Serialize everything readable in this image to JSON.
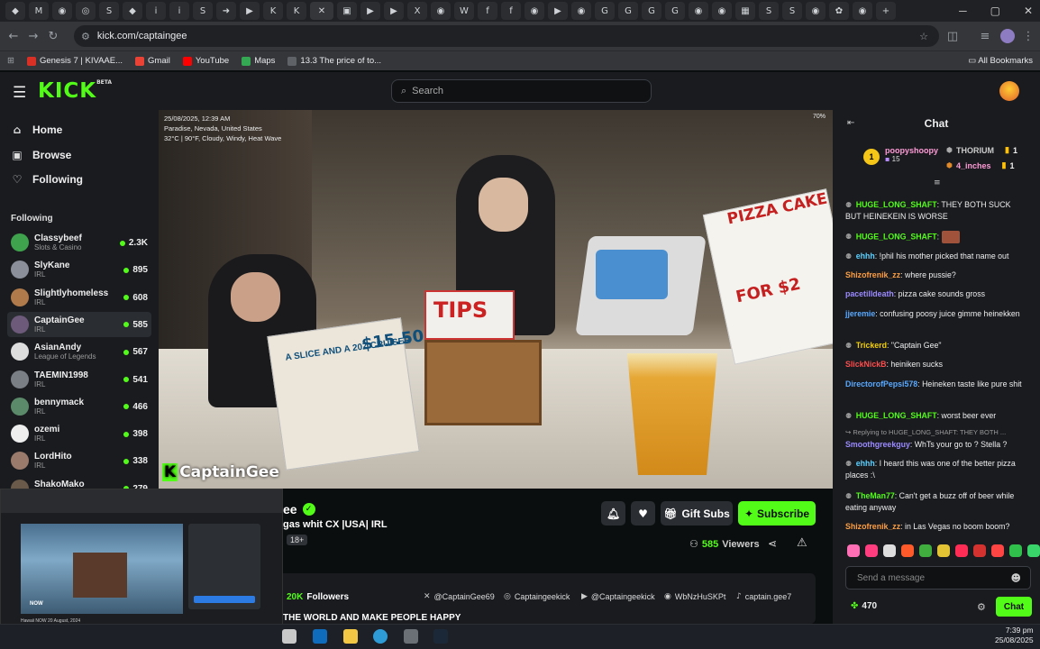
{
  "browser": {
    "tab_glyphs": [
      "◆",
      "M",
      "◉",
      "◎",
      "S",
      "◆",
      "i",
      "i",
      "S",
      "➜",
      "▶",
      "K",
      "K",
      "✕",
      "▣",
      "▶",
      "▶",
      "X",
      "◉",
      "W",
      "f",
      "f",
      "◉",
      "▶",
      "◉",
      "G",
      "G",
      "G",
      "G",
      "◉",
      "◉",
      "▦",
      "S",
      "S",
      "◉",
      "✿",
      "◉"
    ],
    "url": "kick.com/captaingee",
    "bookmarks": [
      {
        "label": "Genesis 7 | KIVAAE...",
        "color": "#d93025"
      },
      {
        "label": "Gmail",
        "color": "#ea4335"
      },
      {
        "label": "YouTube",
        "color": "#ff0000"
      },
      {
        "label": "Maps",
        "color": "#34a853"
      },
      {
        "label": "13.3 The price of to...",
        "color": "#5f6368"
      }
    ],
    "all_bookmarks": "All Bookmarks"
  },
  "header": {
    "logo": "KICK",
    "logo_sup": "BETA",
    "search_placeholder": "Search"
  },
  "sidebar": {
    "nav": [
      {
        "label": "Home",
        "icon": "home-icon"
      },
      {
        "label": "Browse",
        "icon": "browse-icon"
      },
      {
        "label": "Following",
        "icon": "heart-icon"
      }
    ],
    "following_heading": "Following",
    "channels": [
      {
        "name": "Classybeef",
        "category": "Slots & Casino",
        "viewers": "2.3K",
        "color": "#3fa34d"
      },
      {
        "name": "SlyKane",
        "category": "IRL",
        "viewers": "895",
        "color": "#8a8f99"
      },
      {
        "name": "Slightlyhomeless",
        "category": "IRL",
        "viewers": "608",
        "color": "#b07a4a"
      },
      {
        "name": "CaptainGee",
        "category": "IRL",
        "viewers": "585",
        "color": "#6d5a7a"
      },
      {
        "name": "AsianAndy",
        "category": "League of Legends",
        "viewers": "567",
        "color": "#ddd"
      },
      {
        "name": "TAEMIN1998",
        "category": "IRL",
        "viewers": "541",
        "color": "#7a7f86"
      },
      {
        "name": "bennymack",
        "category": "IRL",
        "viewers": "466",
        "color": "#5a8a6a"
      },
      {
        "name": "ozemi",
        "category": "IRL",
        "viewers": "398",
        "color": "#eee"
      },
      {
        "name": "LordHito",
        "category": "IRL",
        "viewers": "338",
        "color": "#9a7a6a"
      },
      {
        "name": "ShakoMako",
        "category": "IRL",
        "viewers": "279",
        "color": "#6a5a4a"
      }
    ]
  },
  "video": {
    "overlay_date": "25/08/2025, 12:39 AM",
    "overlay_location": "Paradise, Nevada, United States",
    "overlay_weather": "32°C | 90°F, Cloudy, Windy, Heat Wave",
    "overlay_pct": "70%",
    "watermark": "CaptainGee",
    "sign_tips": "TIPS",
    "sign_pizza": "PIZZA CAKE",
    "sign_for": "FOR $2",
    "promo_text": "A SLICE AND A 20Z CRUISER",
    "promo_price": "$15.50"
  },
  "stream": {
    "title_fragment": "ee",
    "subtitle_fragment": "gas whit CX  |USA| IRL",
    "age_badge": "18+",
    "gift_subs": "Gift Subs",
    "subscribe": "Subscribe",
    "viewers": "585",
    "viewers_label": "Viewers",
    "followers": "20K",
    "followers_label": "Followers",
    "socials": [
      {
        "icon": "x-icon",
        "glyph": "✕",
        "label": "@CaptainGee69"
      },
      {
        "icon": "instagram-icon",
        "glyph": "◎",
        "label": "Captaingeekick"
      },
      {
        "icon": "youtube-icon",
        "glyph": "▶",
        "label": "@Captaingeekick"
      },
      {
        "icon": "discord-icon",
        "glyph": "◉",
        "label": "WbNzHuSKPt"
      },
      {
        "icon": "tiktok-icon",
        "glyph": "♪",
        "label": "captain.gee7"
      }
    ],
    "bio": "THE WORLD AND MAKE PEOPLE HAPPY"
  },
  "pip": {
    "now": "NOW",
    "caption": "Hawaii NOW 20 August, 2024"
  },
  "chat": {
    "title": "Chat",
    "leader": {
      "rank": "1",
      "name": "poopyshoopy",
      "count": "15"
    },
    "gifters": [
      {
        "name": "THORIUM",
        "count": "1",
        "color": "#ccc"
      },
      {
        "name": "4_inches",
        "count": "1",
        "color": "#ff9bd6"
      }
    ],
    "messages": [
      {
        "user": "HUGE_LONG_SHAFT",
        "color": "#53fc18",
        "badge": true,
        "text": "THEY BOTH SUCK BUT HEINEKEIN IS WORSE"
      },
      {
        "user": "HUGE_LONG_SHAFT",
        "color": "#53fc18",
        "badge": true,
        "text": ""
      },
      {
        "user": "ehhh",
        "color": "#5dd1ff",
        "badge": true,
        "text": "!phil his mother picked that name out"
      },
      {
        "user": "Shizofrenik_zz",
        "color": "#ff9f43",
        "badge": false,
        "text": "where pussie?"
      },
      {
        "user": "pacetilldeath",
        "color": "#9b8bff",
        "badge": false,
        "text": "pizza cake sounds gross"
      },
      {
        "user": "jjeremie",
        "color": "#5aa9ff",
        "badge": false,
        "text": "confusing poosy juice gimme heinekken"
      },
      {
        "user": "Trickerd",
        "color": "#f5d000",
        "badge": true,
        "text": "\"Captain Gee\""
      },
      {
        "user": "SlickNickB",
        "color": "#ff4d4d",
        "badge": false,
        "text": "heiniken sucks"
      },
      {
        "user": "DirectorofPepsi578",
        "color": "#5aa9ff",
        "badge": false,
        "text": "Heineken taste like pure shit"
      },
      {
        "user": "HUGE_LONG_SHAFT",
        "color": "#53fc18",
        "badge": true,
        "text": "worst beer ever"
      },
      {
        "user": "Smoothgreekguy",
        "color": "#9b8bff",
        "badge": false,
        "text": "WhTs your go to ? Stella ?"
      },
      {
        "user": "ehhh",
        "color": "#5dd1ff",
        "badge": true,
        "text": "I heard this was one of the better pizza places :\\"
      },
      {
        "user": "TheMan77",
        "color": "#53fc18",
        "badge": true,
        "text": "Can't get a buzz off of beer while eating anyway"
      },
      {
        "user": "Shizofrenik_zz",
        "color": "#ff9f43",
        "badge": false,
        "text": "in Las Vegas no boom boom?"
      }
    ],
    "reply_text": "Replying to HUGE_LONG_SHAFT: THEY BOTH ...",
    "input_placeholder": "Send a message",
    "points": "470",
    "send": "Chat"
  },
  "taskbar": {
    "time": "7:39 pm",
    "date": "25/08/2025"
  }
}
